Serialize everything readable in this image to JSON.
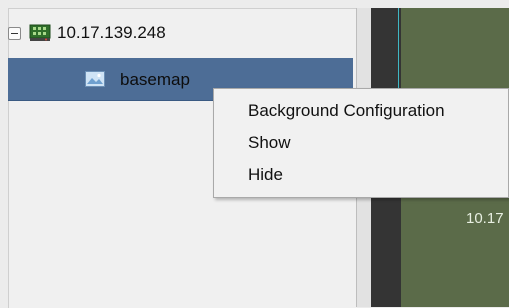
{
  "tree": {
    "root": {
      "label": "10.17.139.248",
      "expanded": true,
      "icon": "device-icon"
    },
    "child": {
      "label": "basemap",
      "icon": "map-image-icon",
      "selected": true
    }
  },
  "context_menu": {
    "items": [
      "Background Configuration",
      "Show",
      "Hide"
    ]
  },
  "map_view": {
    "label": "10.17"
  },
  "colors": {
    "selection": "#4d6d96",
    "map_background": "#5b6b49",
    "dark_bar": "#343434"
  }
}
